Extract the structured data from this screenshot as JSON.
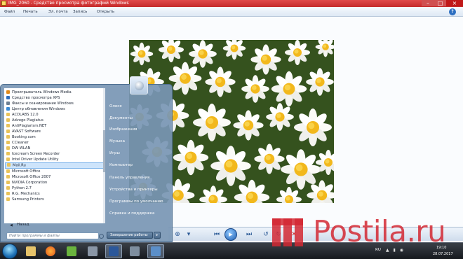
{
  "window": {
    "title": "IMG_2060 - Средство просмотра фотографий Windows"
  },
  "menubar": {
    "items": [
      "Файл",
      "Печать",
      "Эл. почта",
      "Запись",
      "Открыть"
    ]
  },
  "start_menu": {
    "programs": [
      "Проигрыватель Windows Media",
      "Средство просмотра XPS",
      "Факсы и сканирование Windows",
      "Центр обновления Windows",
      "ACDLABS 12.0",
      "Advego Plagiatus",
      "AntiPlagiarism.NET",
      "AVAST Software",
      "Booking.com",
      "CCleaner",
      "DW WLAN",
      "Icecream Screen Recorder",
      "Intel Driver Update Utility",
      "Mail.Ru",
      "Microsoft Office",
      "Microsoft Office 2007",
      "NVIDIA Corporation",
      "Python 2.7",
      "R.G. Mechanics",
      "Samsung Printers"
    ],
    "selected_program": "Mail.Ru",
    "back_label": "Назад",
    "search_placeholder": "Найти программы и файлы",
    "right_items": [
      "Олеся",
      "Документы",
      "Изображения",
      "Музыка",
      "Игры",
      "Компьютер",
      "Панель управления",
      "Устройства и принтеры",
      "Программы по умолчанию",
      "Справка и поддержка"
    ],
    "shutdown_label": "Завершение работы"
  },
  "taskbar": {
    "language": "RU",
    "time": "19:10",
    "date": "28.07.2017"
  },
  "colors": {
    "titlebar": "#c52a2a",
    "accent": "#1f5fb2",
    "watermark": "#d22832"
  }
}
